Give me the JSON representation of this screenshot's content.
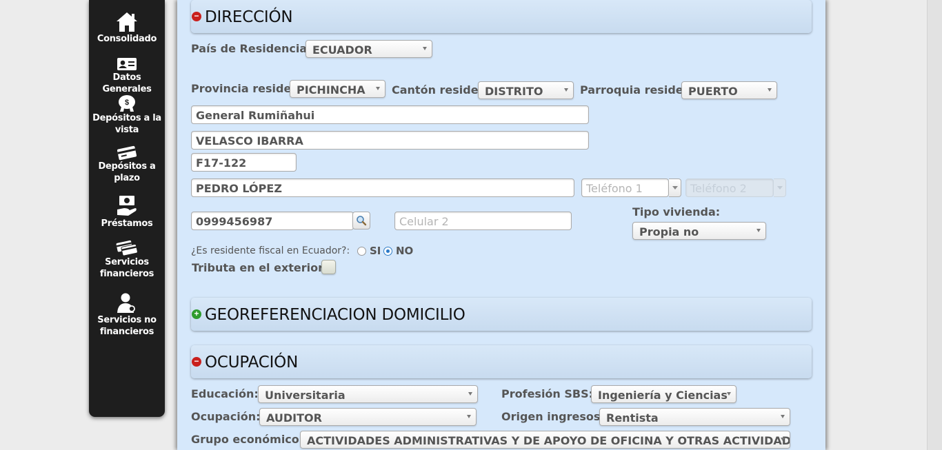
{
  "sidebar": {
    "items": [
      {
        "label": "Consolidado",
        "icon": "home-icon"
      },
      {
        "label": "Datos Generales",
        "icon": "id-card-icon"
      },
      {
        "label": "Depósitos a la vista",
        "icon": "piggy-bank-icon"
      },
      {
        "label": "Depósitos a plazo",
        "icon": "card-icon"
      },
      {
        "label": "Préstamos",
        "icon": "money-hand-icon"
      },
      {
        "label": "Servicios financieros",
        "icon": "cards-icon"
      },
      {
        "label": "Servicios no financieros",
        "icon": "user-service-icon"
      }
    ]
  },
  "direccion": {
    "title": "DIRECCIÓN",
    "pais_label": "País de Residencia:",
    "pais_value": "ECUADOR",
    "provincia_label": "Provincia reside:",
    "provincia_value": "PICHINCHA",
    "canton_label": "Cantón reside:",
    "canton_value": "DISTRITO",
    "parroquia_label": "Parroquia reside:",
    "parroquia_value": "PUERTO",
    "calle1_value": "General Rumiñahui",
    "calle2_value": "VELASCO IBARRA",
    "numero_value": "F17-122",
    "referencia_value": "PEDRO LÓPEZ",
    "telefono1_placeholder": "Teléfono 1",
    "telefono2_placeholder": "Teléfono 2",
    "celular1_value": "0999456987",
    "celular2_placeholder": "Celular 2",
    "tipo_vivienda_label": "Tipo vivienda:",
    "tipo_vivienda_value": "Propia no",
    "residente_label": "¿Es residente fiscal en Ecuador?:",
    "si_label": "SI",
    "no_label": "NO",
    "residente_selected": "NO",
    "tributa_label": "Tributa en el exterior?:",
    "tributa_checked": false
  },
  "georef": {
    "title": "GEOREFERENCIACION DOMICILIO"
  },
  "ocupacion": {
    "title": "OCUPACIÓN",
    "educacion_label": "Educación:",
    "educacion_value": "Universitaria",
    "profesion_label": "Profesión SBS:",
    "profesion_value": "Ingeniería y Ciencias",
    "ocupacion_label": "Ocupación:",
    "ocupacion_value": "AUDITOR",
    "origen_label": "Origen ingresos:",
    "origen_value": "Rentista",
    "grupo_label": "Grupo económico:",
    "grupo_value": "ACTIVIDADES ADMINISTRATIVAS Y DE APOYO DE OFICINA Y OTRAS ACTIVIDADES DE"
  },
  "colors": {
    "sidebar_bg": "#1e1e1e",
    "panel_bg": "#d6e8fb",
    "minus_toggle": "#c9201d",
    "plus_toggle": "#2f9c2e",
    "radio_selected": "#2878c8"
  }
}
